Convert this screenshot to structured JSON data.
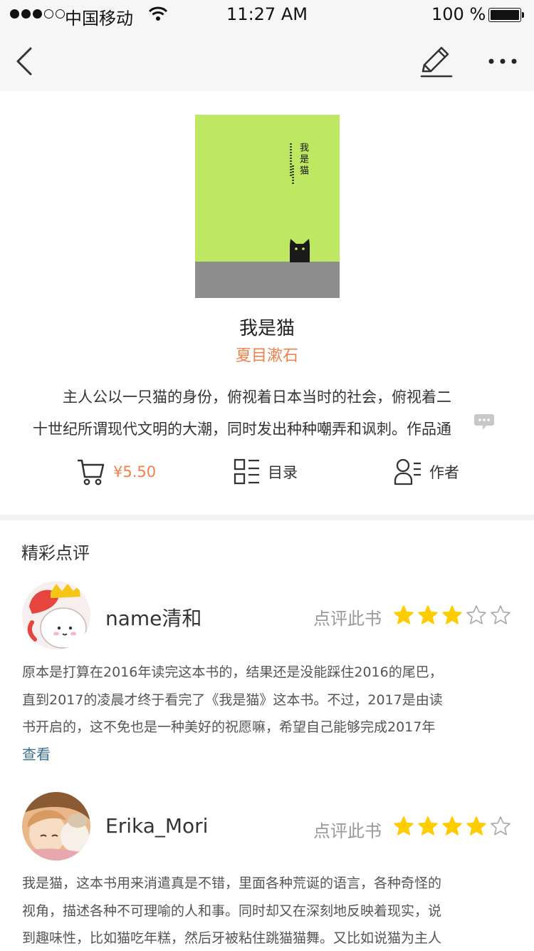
{
  "status_bar": {
    "carrier": "中国移动",
    "time": "11:27 AM",
    "battery": "100 %",
    "signal_bars_filled": 3,
    "signal_bars_total": 5
  },
  "nav": {
    "back_icon": "chevron-left-icon",
    "edit_icon": "edit-pen-icon",
    "more_icon": "more-dots-icon"
  },
  "book": {
    "title": "我是猫",
    "author": "夏目漱石",
    "description_lines": [
      "主人公以一只猫的身份，俯视着日本当时的社会，俯视着二",
      "十世纪所谓现代文明的大潮，同时发出种种嘲弄和讽刺。作品通"
    ],
    "price": "¥5.50",
    "toc_label": "目录",
    "author_label": "作者",
    "cover": {
      "title": "我是猫",
      "colors": {
        "top": "#bfe862",
        "bottom": "#8d8d8d"
      }
    }
  },
  "reviews_section": {
    "title": "精彩点评",
    "rate_label": "点评此书",
    "more_label": "查看",
    "reviews": [
      {
        "user": "name清和",
        "stars": 3,
        "lines": [
          "原本是打算在2016年读完这本书的，结果还是没能踩住2016的尾巴，",
          "直到2017的凌晨才终于看完了《我是猫》这本书。不过，2017是由读",
          "书开启的，这不免也是一种美好的祝愿嘛，希望自己能够完成2017年"
        ]
      },
      {
        "user": "Erika_Mori",
        "stars": 4,
        "lines": [
          "我是猫，这本书用来消遣真是不错，里面各种荒诞的语言，各种奇怪的",
          "视角，描述各种不可理喻的人和事。同时却又在深刻地反映着现实，说",
          "到趣味性，比如猫吃年糕，然后牙被粘住跳猫猫舞。又比如说猫为主人"
        ]
      }
    ]
  },
  "colors": {
    "accent_orange": "#f0814a",
    "star_gold": "#ffcc00",
    "link_blue": "#3a6f8f",
    "cover_green": "#bfe862"
  }
}
